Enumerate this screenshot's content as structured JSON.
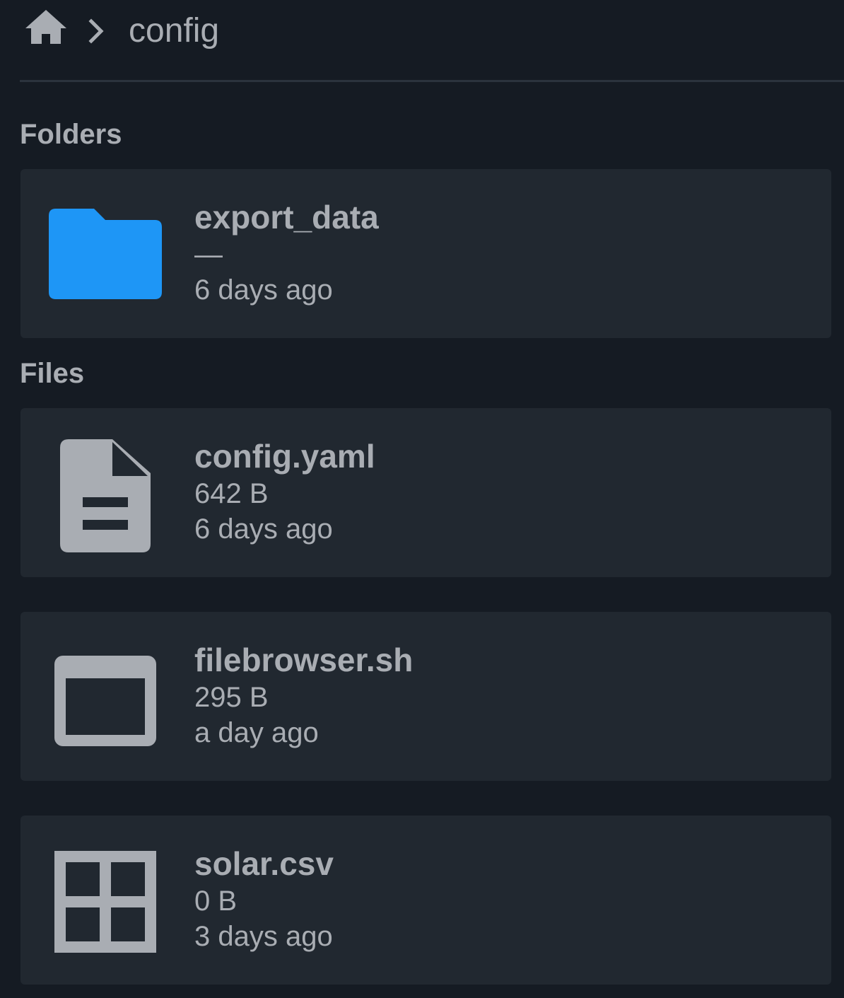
{
  "breadcrumb": {
    "home_icon": "home-icon",
    "separator_icon": "chevron-right-icon",
    "current": "config"
  },
  "sections": {
    "folders_heading": "Folders",
    "files_heading": "Files"
  },
  "folders": [
    {
      "name": "export_data",
      "size": "—",
      "modified": "6 days ago",
      "icon": "folder-icon",
      "icon_color": "#1e96f6"
    }
  ],
  "files": [
    {
      "name": "config.yaml",
      "size": "642 B",
      "modified": "6 days ago",
      "icon": "document-icon"
    },
    {
      "name": "filebrowser.sh",
      "size": "295 B",
      "modified": "a day ago",
      "icon": "terminal-window-icon"
    },
    {
      "name": "solar.csv",
      "size": "0 B",
      "modified": "3 days ago",
      "icon": "table-grid-icon"
    }
  ],
  "colors": {
    "background": "#151b23",
    "card": "#212830",
    "text": "#a9adb3",
    "folder_accent": "#1e96f6",
    "divider": "#2b333d"
  }
}
